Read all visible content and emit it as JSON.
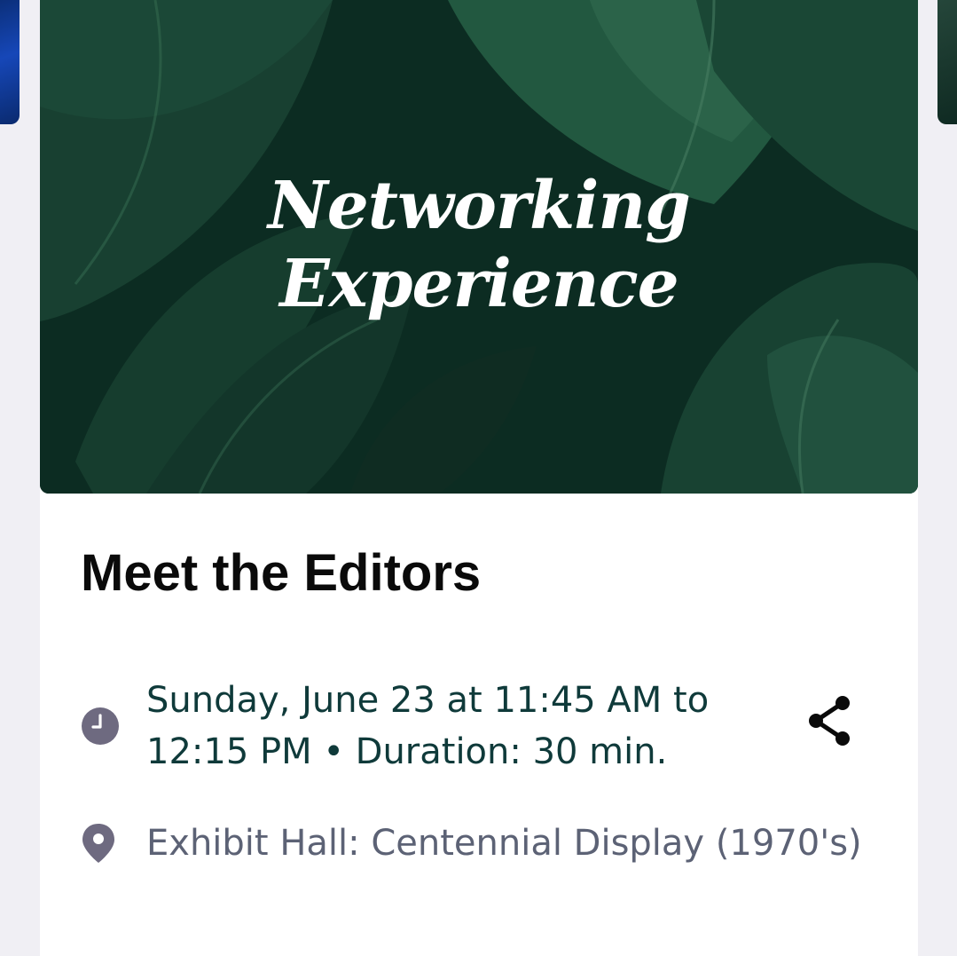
{
  "hero": {
    "title_line1": "Networking",
    "title_line2": "Experience"
  },
  "event": {
    "title": "Meet the Editors",
    "time_text": "Sunday, June 23 at 11:45 AM to 12:15 PM • Duration: 30 min.",
    "location_text": "Exhibit Hall: Centennial Display (1970's)"
  },
  "icons": {
    "time": "clock-icon",
    "location": "map-pin-icon",
    "share": "share-icon"
  },
  "colors": {
    "time_text": "#0f3a3a",
    "location_text": "#5c6275",
    "icon_gray": "#6e6a80",
    "hero_green": "#0f3428"
  }
}
